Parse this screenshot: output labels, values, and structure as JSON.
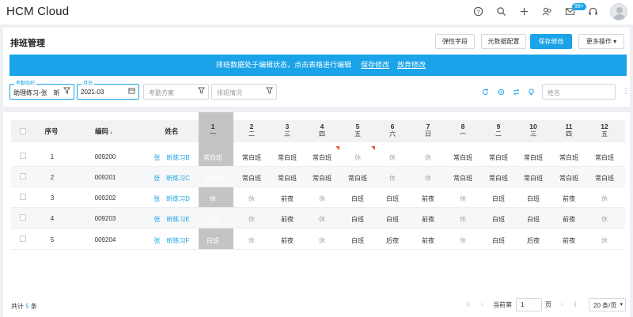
{
  "app": {
    "title": "HCM Cloud",
    "notification_count": "99+"
  },
  "header": {
    "page_title": "排班管理",
    "buttons": [
      "弹性字段",
      "元数据配置",
      "保存修改",
      "更多操作 ▾"
    ]
  },
  "banner": {
    "message": "排班数据处于编辑状态，点击表格进行编辑",
    "save_link": "保存修改",
    "discard_link": "放弃修改"
  },
  "filters": {
    "org": {
      "label": "考勤组织",
      "value": "助理练习-张　昕"
    },
    "month": {
      "label": "月份",
      "value": "2021-03"
    },
    "plan_placeholder": "考勤方案",
    "status_placeholder": "排班情况",
    "search_placeholder": "姓名"
  },
  "table": {
    "headers": {
      "seq": "序号",
      "code": "编码",
      "name": "姓名"
    },
    "days": [
      {
        "d": "1",
        "w": "一"
      },
      {
        "d": "2",
        "w": "二"
      },
      {
        "d": "3",
        "w": "三"
      },
      {
        "d": "4",
        "w": "四"
      },
      {
        "d": "5",
        "w": "五"
      },
      {
        "d": "6",
        "w": "六"
      },
      {
        "d": "7",
        "w": "日"
      },
      {
        "d": "8",
        "w": "一"
      },
      {
        "d": "9",
        "w": "二"
      },
      {
        "d": "10",
        "w": "三"
      },
      {
        "d": "11",
        "w": "四"
      },
      {
        "d": "12",
        "w": "五"
      }
    ],
    "rows": [
      {
        "seq": "1",
        "code": "009200",
        "name": "张　昕练习B",
        "shifts": [
          "常白班",
          "常白班",
          "常白班",
          "常白班",
          "休",
          "休",
          "休",
          "常白班",
          "常白班",
          "常白班",
          "常白班",
          "常白班"
        ],
        "flags": [
          3,
          4
        ]
      },
      {
        "seq": "2",
        "code": "009201",
        "name": "张　昕练习C",
        "shifts": [
          "常白班",
          "常白班",
          "常白班",
          "常白班",
          "常白班",
          "休",
          "休",
          "常白班",
          "常白班",
          "常白班",
          "常白班",
          "常白班"
        ],
        "flags": []
      },
      {
        "seq": "3",
        "code": "009202",
        "name": "张　昕练习D",
        "shifts": [
          "休",
          "休",
          "前夜",
          "休",
          "白班",
          "白班",
          "前夜",
          "休",
          "白班",
          "白班",
          "前夜",
          "休"
        ],
        "flags": []
      },
      {
        "seq": "4",
        "code": "009203",
        "name": "张　昕练习E",
        "shifts": [
          "白班",
          "休",
          "前夜",
          "休",
          "白班",
          "白班",
          "前夜",
          "休",
          "白班",
          "白班",
          "前夜",
          "休"
        ],
        "flags": []
      },
      {
        "seq": "5",
        "code": "009204",
        "name": "张　昕练习F",
        "shifts": [
          "白班",
          "休",
          "前夜",
          "休",
          "白班",
          "后夜",
          "前夜",
          "休",
          "白班",
          "后夜",
          "前夜",
          "休"
        ],
        "flags": []
      }
    ]
  },
  "footer": {
    "total_prefix": "共计",
    "total_count": "5",
    "total_suffix": "条",
    "current_page_label": "当前第",
    "page_value": "1",
    "page_suffix": "页",
    "page_size": "20 条/页"
  },
  "colors": {
    "accent": "#1aa3e8",
    "selected_column": "#c4c4c4",
    "flag": "#e8542c"
  }
}
